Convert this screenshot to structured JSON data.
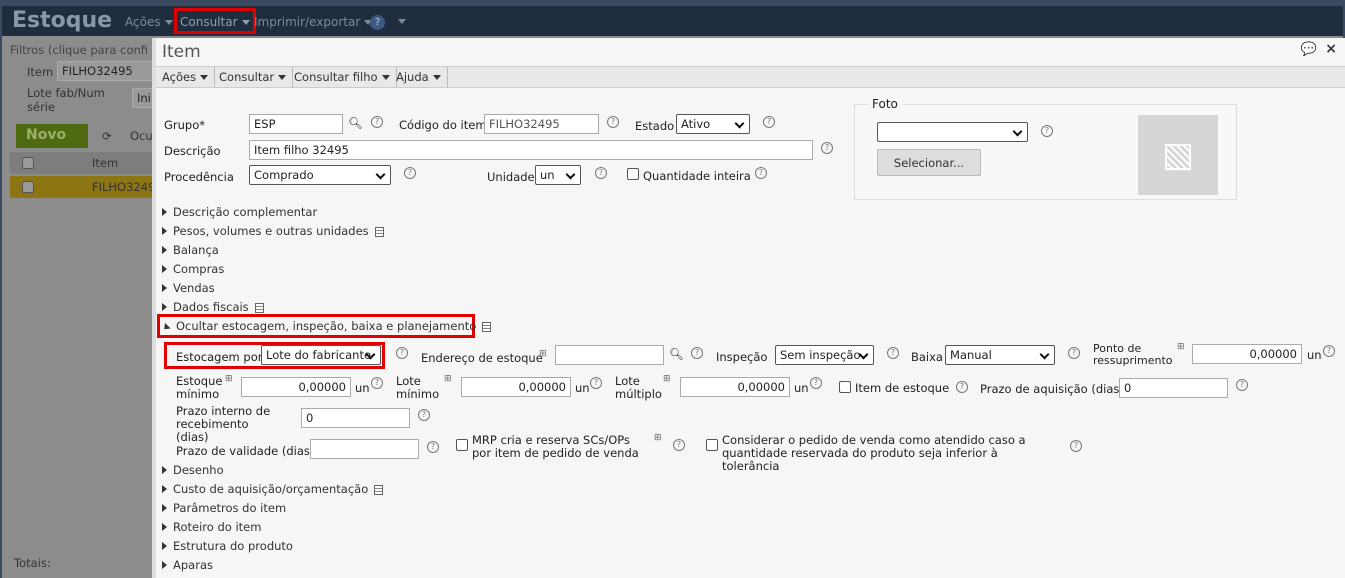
{
  "app": {
    "title": "Estoque",
    "menu": [
      "Ações",
      "Consultar",
      "Imprimir/exportar"
    ],
    "help": "?",
    "filters_label": "Filtros (clique para confi",
    "item_label": "Item",
    "item_value": "FILHO32495",
    "lote_label": "Lote fab/Num série",
    "lote_value": "Ini",
    "new_button": "Novo",
    "hide_button": "Ocu",
    "col_item": "Item",
    "row_item": "FILHO3249",
    "totals": "Totais:"
  },
  "dialog": {
    "title": "Item",
    "toolbar": [
      "Ações",
      "Consultar",
      "Consultar filho",
      "Ajuda"
    ],
    "grupo_label": "Grupo*",
    "grupo_value": "ESP",
    "codigo_label": "Código do item",
    "codigo_value": "FILHO32495",
    "estado_label": "Estado",
    "estado_value": "Ativo",
    "descricao_label": "Descrição",
    "descricao_value": "Item filho 32495",
    "procedencia_label": "Procedência",
    "procedencia_value": "Comprado",
    "unidade_label": "Unidade",
    "unidade_value": "un",
    "qtd_inteira_label": "Quantidade inteira",
    "foto_label": "Foto",
    "foto_select_value": "",
    "selecionar_button": "Selecionar...",
    "sections_top": [
      "Descrição complementar",
      "Pesos, volumes e outras unidades",
      "Balança",
      "Compras",
      "Vendas",
      "Dados fiscais"
    ],
    "open_section": "Ocultar estocagem, inspeção, baixa e planejamento",
    "estocagem_label": "Estocagem por",
    "estocagem_value": "Lote do fabricante",
    "endereco_label": "Endereço de estoque",
    "endereco_value": "",
    "inspecao_label": "Inspeção",
    "inspecao_value": "Sem inspeção",
    "baixa_label": "Baixa",
    "baixa_value": "Manual",
    "ponto_label": "Ponto de ressuprimento",
    "ponto_value": "0,00000",
    "unit": "un",
    "estoque_min_label": "Estoque mínimo",
    "estoque_min_value": "0,00000",
    "lote_min_label": "Lote mínimo",
    "lote_min_value": "0,00000",
    "lote_mult_label": "Lote múltiplo",
    "lote_mult_value": "0,00000",
    "item_estoque_label": "Item de estoque",
    "prazo_aq_label": "Prazo de aquisição (dias)",
    "prazo_aq_value": "0",
    "prazo_int_label": "Prazo interno de recebimento (dias)",
    "prazo_int_value": "0",
    "prazo_val_label": "Prazo de validade (dias)",
    "prazo_val_value": "",
    "mrp_label": "MRP cria e reserva SCs/OPs por item de pedido de venda",
    "considerar_label": "Considerar o pedido de venda como atendido caso a quantidade reservada do produto seja inferior à tolerância",
    "sections_bottom": [
      "Desenho",
      "Custo de aquisição/orçamentação",
      "Parâmetros do item",
      "Roteiro do item",
      "Estrutura do produto",
      "Aparas"
    ]
  }
}
